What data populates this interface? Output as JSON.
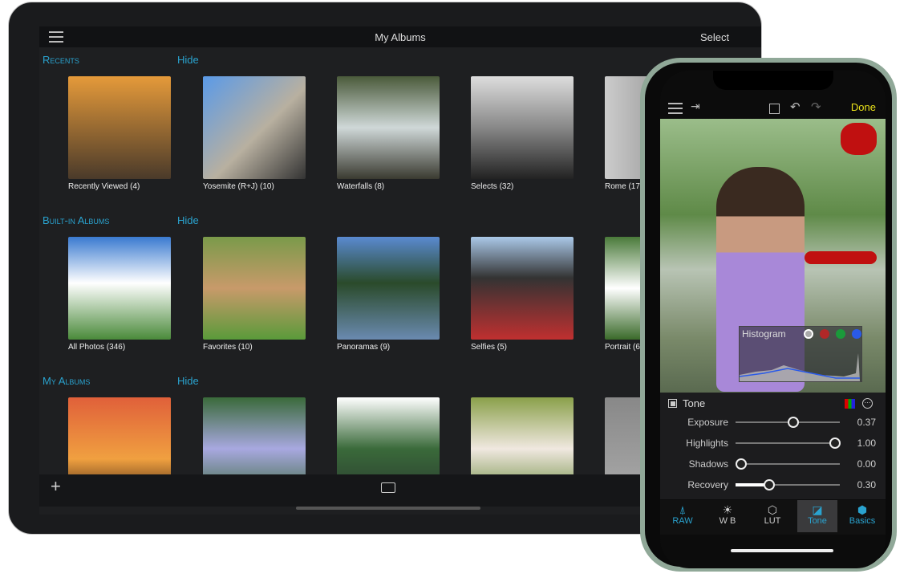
{
  "ipad": {
    "title": "My Albums",
    "select": "Select",
    "sections": [
      {
        "title": "Recents",
        "hide": "Hide",
        "albums": [
          {
            "label": "Recently Viewed (4)",
            "color": "linear-gradient(#e59a3a,#4a3a2a)"
          },
          {
            "label": "Yosemite (R+J) (10)",
            "color": "linear-gradient(135deg,#5a9ae8,#b8b0a0 55%,#333)"
          },
          {
            "label": "Waterfalls (8)",
            "color": "linear-gradient(#4a5a3a,#cfd8d8 50%,#3a3a30)"
          },
          {
            "label": "Selects (32)",
            "color": "linear-gradient(#ddd,#888 50%,#222)"
          },
          {
            "label": "Rome (17)",
            "color": "linear-gradient(90deg,#ccc,#777)"
          }
        ]
      },
      {
        "title": "Built-in Albums",
        "hide": "Hide",
        "albums": [
          {
            "label": "All Photos (346)",
            "color": "linear-gradient(#3a7ad0,#fff 45%,#4a8a3a)"
          },
          {
            "label": "Favorites (10)",
            "color": "linear-gradient(#7a9a4a,#c89a6a 50%,#5a9a3a)"
          },
          {
            "label": "Panoramas (9)",
            "color": "linear-gradient(#5a8ad0,#2a4a2a 45%,#6a8ab0)"
          },
          {
            "label": "Selfies (5)",
            "color": "linear-gradient(#aac8e8,#333 40%,#c03030)"
          },
          {
            "label": "Portrait (6)",
            "color": "linear-gradient(#4a7a3a,#fff 50%,#3a6a2a)"
          }
        ]
      },
      {
        "title": "My Albums",
        "hide": "Hide",
        "albums": [
          {
            "label": "",
            "color": "linear-gradient(#e0603a,#f0a040 60%,#3a2010)"
          },
          {
            "label": "",
            "color": "linear-gradient(#3a6a3a,#a8a8e0 50%,#3a6a3a)"
          },
          {
            "label": "",
            "color": "linear-gradient(#fff,#3a6a3a 50%,#2a3a30)"
          },
          {
            "label": "",
            "color": "linear-gradient(#8aa04a,#f0e8e0 50%,#6a8a3a)"
          },
          {
            "label": "",
            "color": "linear-gradient(#888,#aaa)"
          }
        ]
      }
    ]
  },
  "phone": {
    "done": "Done",
    "histogram": "Histogram",
    "panel_title": "Tone",
    "sliders": [
      {
        "label": "Exposure",
        "value": "0.37",
        "pos": 0.55
      },
      {
        "label": "Highlights",
        "value": "1.00",
        "pos": 0.95
      },
      {
        "label": "Shadows",
        "value": "0.00",
        "pos": 0.05
      },
      {
        "label": "Recovery",
        "value": "0.30",
        "pos": 0.32
      }
    ],
    "tabs": [
      {
        "label": "RAW",
        "icon": "⍋"
      },
      {
        "label": "W B",
        "icon": "☀"
      },
      {
        "label": "LUT",
        "icon": "⬡"
      },
      {
        "label": "Tone",
        "icon": "◪"
      },
      {
        "label": "Basics",
        "icon": "⬢"
      }
    ],
    "active_tab": "Tone",
    "accent": "#2aa3cf"
  }
}
